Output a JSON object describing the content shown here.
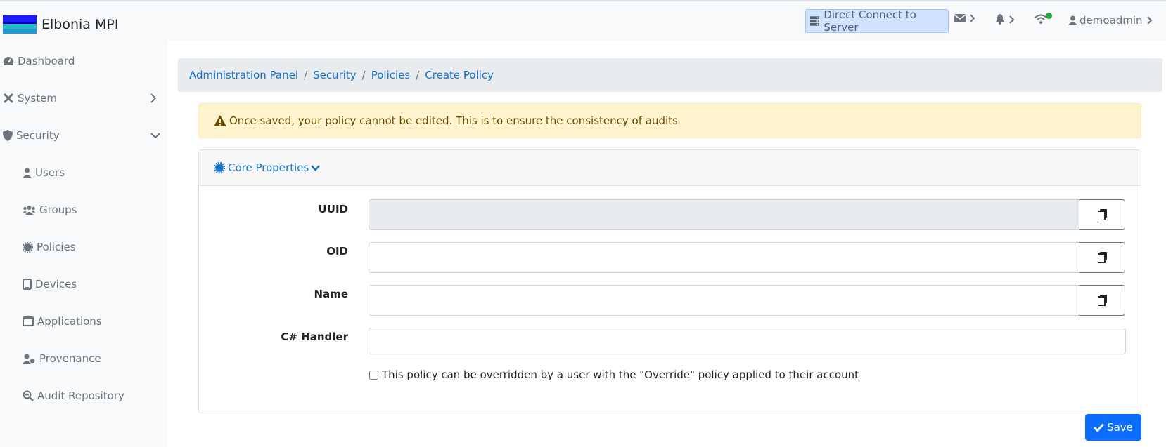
{
  "app": {
    "title": "Elbonia MPI"
  },
  "topbar": {
    "direct_connect_label": "Direct Connect to Server",
    "user_label": "demoadmin"
  },
  "sidebar": {
    "items": [
      {
        "label": "Dashboard",
        "icon": "dashboard-icon"
      },
      {
        "label": "System",
        "icon": "tools-icon"
      },
      {
        "label": "Security",
        "icon": "shield-icon"
      },
      {
        "label": "Users",
        "icon": "user-icon"
      },
      {
        "label": "Groups",
        "icon": "users-icon"
      },
      {
        "label": "Policies",
        "icon": "certificate-icon"
      },
      {
        "label": "Devices",
        "icon": "tablet-icon"
      },
      {
        "label": "Applications",
        "icon": "window-icon"
      },
      {
        "label": "Provenance",
        "icon": "user-shield-icon"
      },
      {
        "label": "Audit Repository",
        "icon": "search-plus-icon"
      }
    ]
  },
  "breadcrumb": [
    "Administration Panel",
    "Security",
    "Policies",
    "Create Policy"
  ],
  "alert": {
    "text": "Once saved, your policy cannot be edited. This is to ensure the consistency of audits"
  },
  "card": {
    "title": "Core Properties",
    "fields": {
      "uuid": {
        "label": "UUID",
        "value": ""
      },
      "oid": {
        "label": "OID",
        "value": ""
      },
      "name": {
        "label": "Name",
        "value": ""
      },
      "handler": {
        "label": "C# Handler",
        "value": ""
      }
    },
    "override_checkbox": {
      "label": "This policy can be overridden by a user with the \"Override\" policy applied to their account",
      "checked": false
    }
  },
  "actions": {
    "save_label": "Save"
  },
  "colors": {
    "primary": "#0d6efd",
    "alert_bg": "#fff3cd",
    "status_online": "#28a745"
  }
}
